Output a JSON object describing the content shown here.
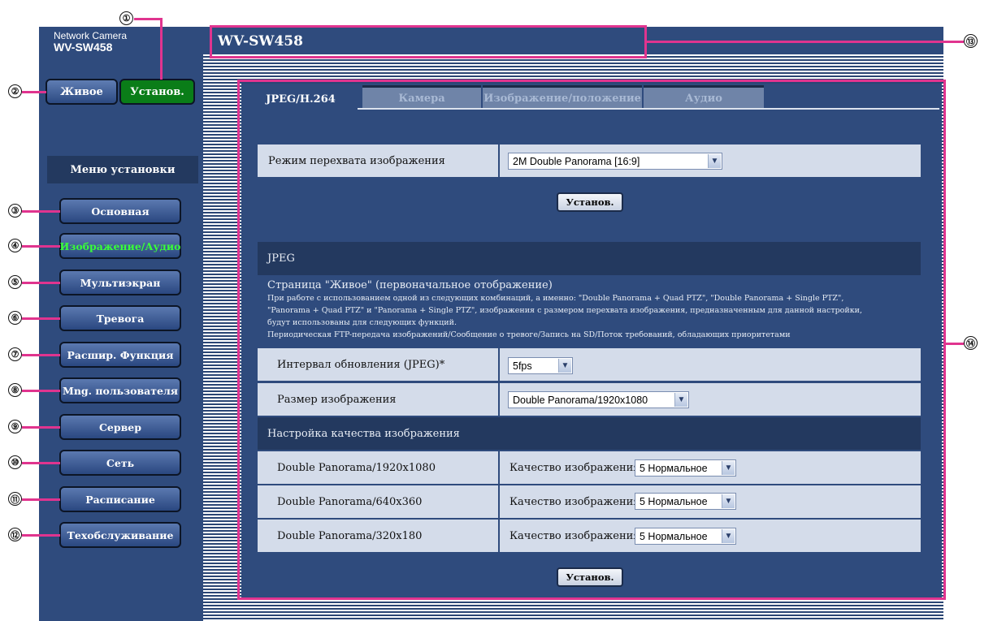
{
  "brand": {
    "line1": "Network Camera",
    "line2": "WV-SW458"
  },
  "top_buttons": {
    "live": "Живое",
    "setup": "Установ."
  },
  "menu": {
    "title": "Меню установки",
    "items": [
      {
        "label": "Основная"
      },
      {
        "label": "Изображение/Аудио",
        "active": true
      },
      {
        "label": "Мультиэкран"
      },
      {
        "label": "Тревога"
      },
      {
        "label": "Расшир. Функция"
      },
      {
        "label": "Mng. пользователя"
      },
      {
        "label": "Сервер"
      },
      {
        "label": "Сеть"
      },
      {
        "label": "Расписание"
      },
      {
        "label": "Техобслуживание"
      }
    ]
  },
  "header": {
    "title": "WV-SW458"
  },
  "tabs": [
    {
      "label": "JPEG/H.264",
      "active": true
    },
    {
      "label": "Камера"
    },
    {
      "label": "Изображение/положение"
    },
    {
      "label": "Аудио"
    }
  ],
  "capture": {
    "label": "Режим перехвата изображения",
    "value": "2M Double Panorama [16:9]",
    "button": "Установ."
  },
  "jpeg": {
    "section": "JPEG",
    "note_title": "Страница \"Живое\" (первоначальное отображение)",
    "note_lines": [
      "При работе с использованием одной из следующих комбинаций, а именно: \"Double Panorama + Quad PTZ\", \"Double Panorama + Single PTZ\",",
      "\"Panorama + Quad PTZ\" и \"Panorama + Single PTZ\", изображения с размером перехвата изображения, предназначенным для данной настройки,",
      "будут использованы для следующих функций.",
      "Периодическая FTP-передача изображений/Сообщение о тревоге/Запись на SD/Поток требований, обладающих приоритетами"
    ],
    "refresh_label": "Интервал обновления (JPEG)*",
    "refresh_value": "5fps",
    "size_label": "Размер изображения",
    "size_value": "Double Panorama/1920x1080",
    "quality_section": "Настройка качества изображения",
    "quality_rows": [
      {
        "label": "Double Panorama/1920x1080",
        "prefix": "Качество изображения",
        "value": "5 Нормальное"
      },
      {
        "label": "Double Panorama/640x360",
        "prefix": "Качество изображения",
        "value": "5 Нормальное"
      },
      {
        "label": "Double Panorama/320x180",
        "prefix": "Качество изображения",
        "value": "5 Нормальное"
      }
    ],
    "button": "Установ."
  },
  "callouts": [
    "①",
    "②",
    "③",
    "④",
    "⑤",
    "⑥",
    "⑦",
    "⑧",
    "⑨",
    "⑩",
    "⑪",
    "⑫",
    "⑬",
    "⑭"
  ],
  "colors": {
    "panel": "#2f4b7d",
    "active_tab_green": "#0a7d18",
    "highlight": "#e0348f",
    "active_text": "#39ff39"
  }
}
